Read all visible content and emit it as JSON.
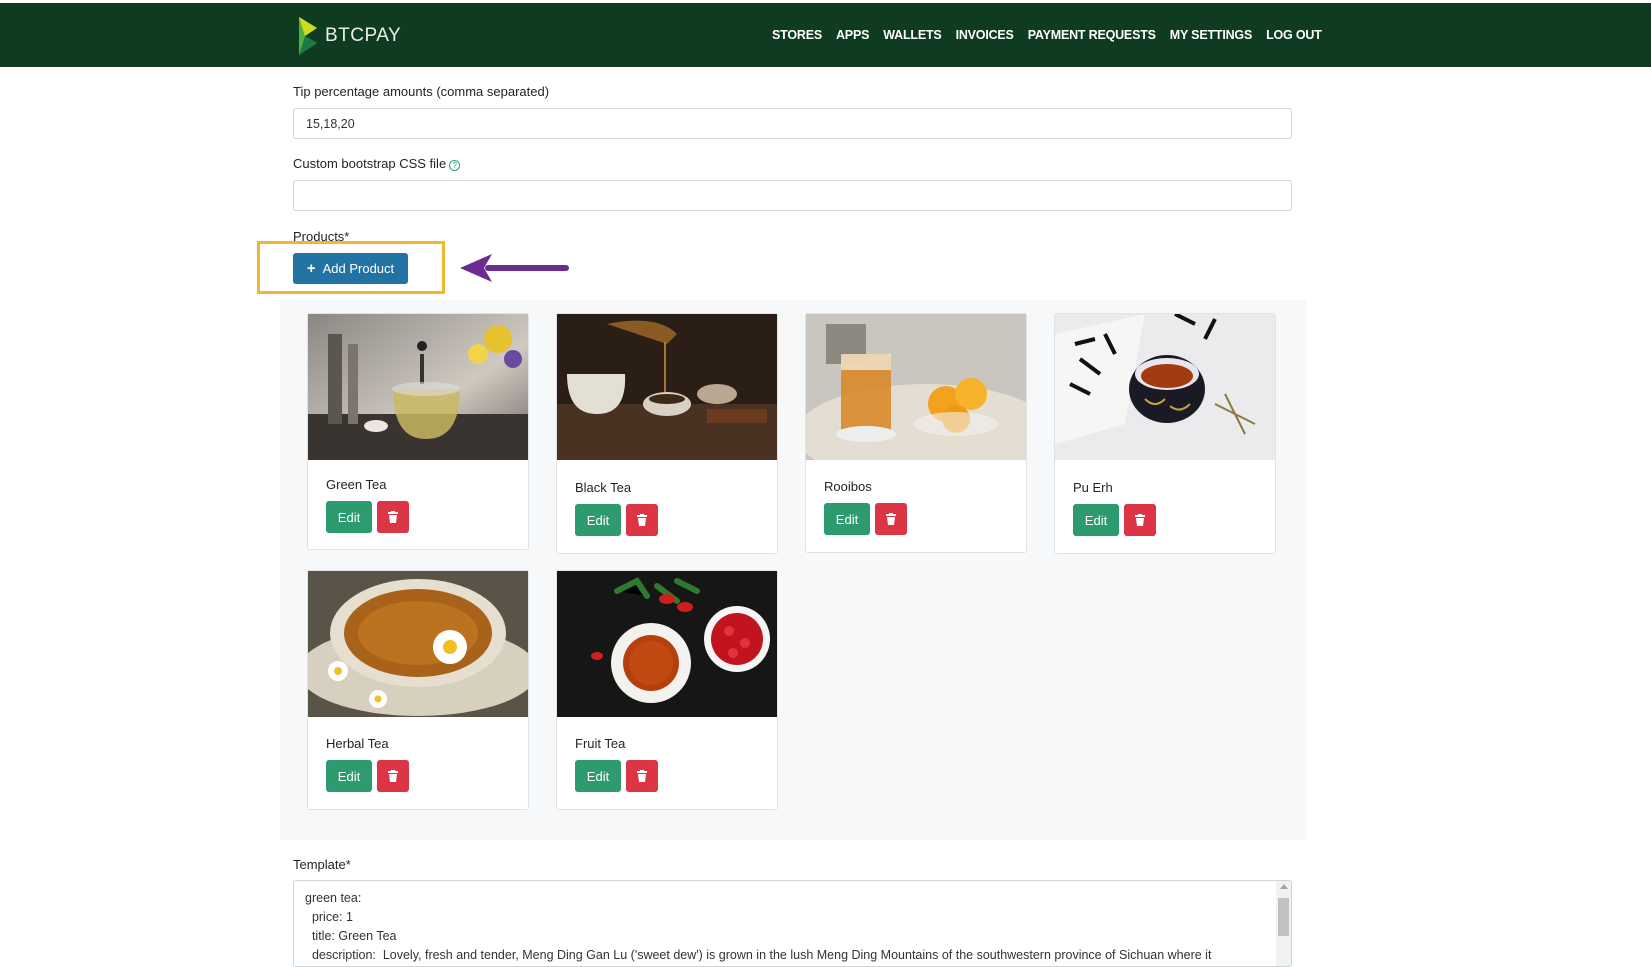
{
  "navbar": {
    "brand": "BTCPAY",
    "items": [
      "STORES",
      "APPS",
      "WALLETS",
      "INVOICES",
      "PAYMENT REQUESTS",
      "MY SETTINGS",
      "LOG OUT"
    ]
  },
  "form": {
    "tip_label": "Tip percentage amounts (comma separated)",
    "tip_value": "15,18,20",
    "css_label": "Custom bootstrap CSS file",
    "css_value": "",
    "products_label": "Products*",
    "add_product_label": "Add Product",
    "template_label": "Template*",
    "template_lines": [
      "green tea:",
      "  price: 1",
      "  title: Green Tea",
      "  description:  Lovely, fresh and tender, Meng Ding Gan Lu ('sweet dew') is grown in the lush Meng Ding Mountains of the southwestern province of Sichuan where it"
    ]
  },
  "products": [
    {
      "title": "Green Tea",
      "edit_label": "Edit",
      "image": "teapot-flowers"
    },
    {
      "title": "Black Tea",
      "edit_label": "Edit",
      "image": "pouring-tea"
    },
    {
      "title": "Rooibos",
      "edit_label": "Edit",
      "image": "iced-tea-orange"
    },
    {
      "title": "Pu Erh",
      "edit_label": "Edit",
      "image": "cup-calligraphy"
    },
    {
      "title": "Herbal Tea",
      "edit_label": "Edit",
      "image": "chamomile-cup"
    },
    {
      "title": "Fruit Tea",
      "edit_label": "Edit",
      "image": "rosehip-tea"
    }
  ],
  "colors": {
    "navbar": "#0f3b21",
    "primary": "#2273a3",
    "edit": "#2e9a6f",
    "delete": "#dc3545",
    "highlight": "#f0b731",
    "arrow": "#6c2b91"
  }
}
